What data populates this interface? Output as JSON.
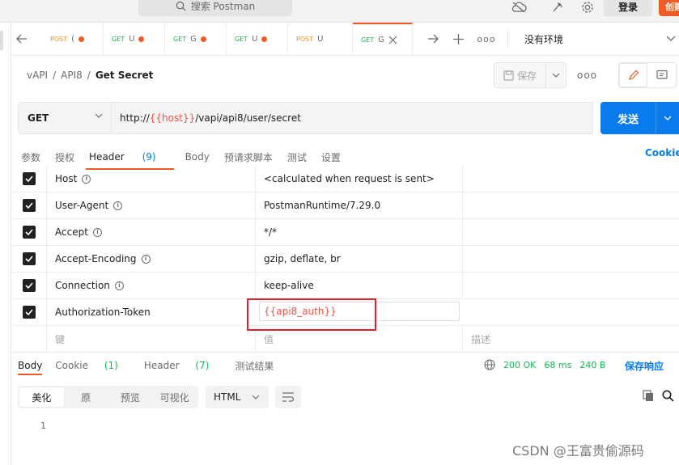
{
  "topbar": {
    "search_placeholder": "搜索 Postman",
    "login_label": "登录",
    "create_label": "创建"
  },
  "tabs": [
    {
      "method": "POST",
      "name": "(",
      "method_color": "#ef8a2c",
      "dirty": true
    },
    {
      "method": "GET",
      "name": "U",
      "method_color": "#0cbb52",
      "dirty": true
    },
    {
      "method": "GET",
      "name": "G",
      "method_color": "#0cbb52",
      "dirty": true
    },
    {
      "method": "GET",
      "name": "U",
      "method_color": "#0cbb52",
      "dirty": true
    },
    {
      "method": "POST",
      "name": "U",
      "method_color": "#ef8a2c",
      "dirty": false
    },
    {
      "method": "GET",
      "name": "G",
      "method_color": "#0cbb52",
      "dirty": false,
      "active": true
    }
  ],
  "environment": {
    "label": "没有环境"
  },
  "breadcrumb": {
    "part1": "vAPI",
    "sep": "/",
    "part2": "API8",
    "current": "Get Secret"
  },
  "actions": {
    "save_label": "保存",
    "more_label": "ooo"
  },
  "request": {
    "method": "GET",
    "url_prefix": "http://",
    "url_var": "{{host}}",
    "url_path": "/vapi/api8/user/secret",
    "send_label": "发送"
  },
  "request_tabs": {
    "params": "参数",
    "auth": "授权",
    "headers": "Header",
    "headers_count": "(9)",
    "body": "Body",
    "prerequest": "预请求脚本",
    "tests": "测试",
    "settings": "设置",
    "cookies": "Cookie"
  },
  "headers": [
    {
      "key": "Host",
      "value": "<calculated when request is sent>",
      "info": true
    },
    {
      "key": "User-Agent",
      "value": "PostmanRuntime/7.29.0",
      "info": true
    },
    {
      "key": "Accept",
      "value": "*/*",
      "info": true
    },
    {
      "key": "Accept-Encoding",
      "value": "gzip, deflate, br",
      "info": true
    },
    {
      "key": "Connection",
      "value": "keep-alive",
      "info": true
    },
    {
      "key": "Authorization-Token",
      "value": "{{api8_auth}}",
      "info": false
    }
  ],
  "headers_placeholder": {
    "key": "键",
    "value": "值",
    "description": "描述"
  },
  "response": {
    "tabs": {
      "body": "Body",
      "cookie": "Cookie",
      "cookie_count": "(1)",
      "header": "Header",
      "header_count": "(7)",
      "tests": "测试结果"
    },
    "status": "200 OK",
    "time": "68 ms",
    "size": "240 B",
    "save_label": "保存响应",
    "formats": [
      "美化",
      "原",
      "预览",
      "可视化"
    ],
    "language": "HTML",
    "line_number": "1"
  },
  "watermark": "CSDN @王富贵偷源码"
}
